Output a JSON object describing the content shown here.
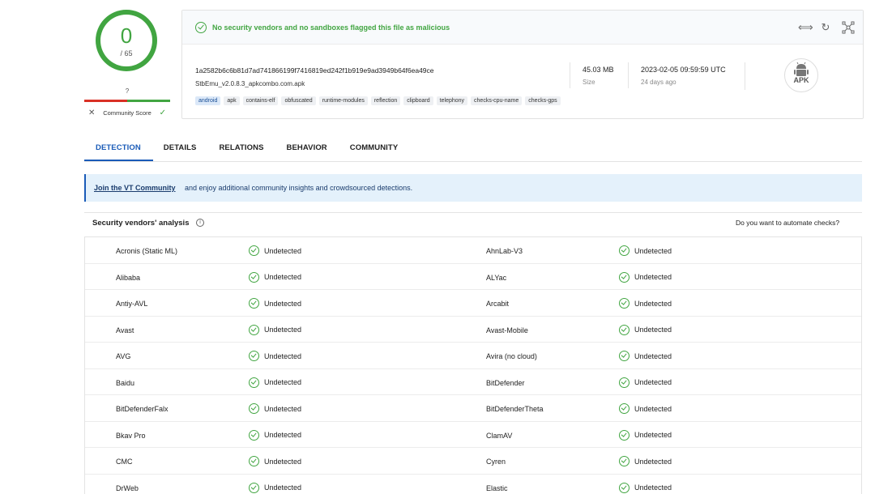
{
  "score": {
    "value": "0",
    "total": "/ 65",
    "community_question": "?",
    "community_label": "Community Score",
    "down_icon": "close-icon",
    "up_icon": "check-icon"
  },
  "summary": {
    "banner_text": "No security vendors and no sandboxes flagged this file as malicious",
    "hash": "1a2582b6c6b81d7ad741866199f7416819ed242f1b919e9ad3949b64f6ea49ce",
    "filename": "StbEmu_v2.0.8.3_apkcombo.com.apk",
    "tags": [
      "android",
      "apk",
      "contains-elf",
      "obfuscated",
      "runtime-modules",
      "reflection",
      "clipboard",
      "telephony",
      "checks-cpu-name",
      "checks-gps"
    ],
    "size_value": "45.03 MB",
    "size_label": "Size",
    "date_value": "2023-02-05 09:59:59 UTC",
    "date_label": "24 days ago",
    "file_type": "APK",
    "tool_icons": [
      "compare-icon",
      "reanalyze-icon",
      "graph-icon"
    ]
  },
  "tabs": [
    "DETECTION",
    "DETAILS",
    "RELATIONS",
    "BEHAVIOR",
    "COMMUNITY"
  ],
  "info_banner": {
    "link": "Join the VT Community",
    "text": "and enjoy additional community insights and crowdsourced detections."
  },
  "analysis": {
    "title": "Security vendors' analysis",
    "info_icon": "ⓘ",
    "automate": "Do you want to automate checks?"
  },
  "vendors": [
    {
      "left": "Acronis (Static ML)",
      "left_result": "Undetected",
      "right": "AhnLab-V3",
      "right_result": "Undetected"
    },
    {
      "left": "Alibaba",
      "left_result": "Undetected",
      "right": "ALYac",
      "right_result": "Undetected"
    },
    {
      "left": "Antiy-AVL",
      "left_result": "Undetected",
      "right": "Arcabit",
      "right_result": "Undetected"
    },
    {
      "left": "Avast",
      "left_result": "Undetected",
      "right": "Avast-Mobile",
      "right_result": "Undetected"
    },
    {
      "left": "AVG",
      "left_result": "Undetected",
      "right": "Avira (no cloud)",
      "right_result": "Undetected"
    },
    {
      "left": "Baidu",
      "left_result": "Undetected",
      "right": "BitDefender",
      "right_result": "Undetected"
    },
    {
      "left": "BitDefenderFalx",
      "left_result": "Undetected",
      "right": "BitDefenderTheta",
      "right_result": "Undetected"
    },
    {
      "left": "Bkav Pro",
      "left_result": "Undetected",
      "right": "ClamAV",
      "right_result": "Undetected"
    },
    {
      "left": "CMC",
      "left_result": "Undetected",
      "right": "Cyren",
      "right_result": "Undetected"
    },
    {
      "left": "DrWeb",
      "left_result": "Undetected",
      "right": "Elastic",
      "right_result": "Undetected"
    }
  ],
  "colors": {
    "green": "#41a541",
    "red": "#d93025",
    "accent": "#1a5bb8",
    "info_bg": "#e4f1fb"
  }
}
